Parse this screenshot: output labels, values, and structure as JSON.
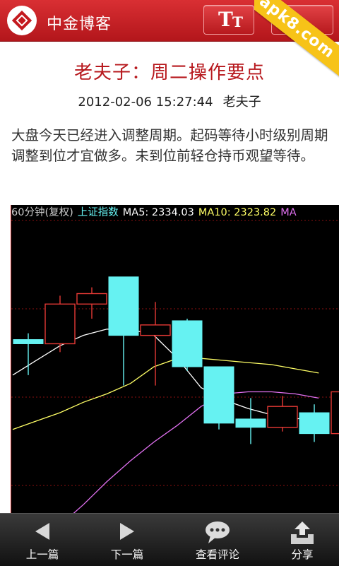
{
  "header": {
    "app_title": "中金博客",
    "font_button": {
      "big": "T",
      "small": "T"
    },
    "watermark": "apk8.com"
  },
  "article": {
    "title": "老夫子：周二操作要点",
    "date": "2012-02-06 15:27:44",
    "author": "老夫子",
    "body": "大盘今天已经进入调整周期。起码等待小时级别周期调整到位才宜做多。未到位前轻仓持币观望等待。"
  },
  "chart_data": {
    "type": "candlestick",
    "period_label": "60分钟(复权)",
    "index_label": "上证指数",
    "ma5_label": "MA5: 2334.03",
    "ma10_label": "MA10: 2323.82",
    "ma20_label": "MA",
    "colors": {
      "background": "#000000",
      "up": "#e53935",
      "down": "#66f2f2",
      "ma5": "#ffffff",
      "ma10": "#ffff66",
      "ma20": "#e070f0",
      "grid": "#8b1010",
      "label_grey": "#cccccc",
      "label_cyan": "#66f2f2"
    },
    "ylim": [
      2300,
      2370
    ],
    "candles": [
      {
        "o": 2341.5,
        "h": 2343.0,
        "l": 2333.0,
        "c": 2340.5
      },
      {
        "o": 2340.5,
        "h": 2352.0,
        "l": 2338.5,
        "c": 2350.0
      },
      {
        "o": 2350.0,
        "h": 2354.0,
        "l": 2346.5,
        "c": 2352.5
      },
      {
        "o": 2356.5,
        "h": 2356.5,
        "l": 2330.5,
        "c": 2342.5
      },
      {
        "o": 2342.5,
        "h": 2350.5,
        "l": 2330.5,
        "c": 2345.0
      },
      {
        "o": 2346.0,
        "h": 2346.5,
        "l": 2334.0,
        "c": 2335.0
      },
      {
        "o": 2335.0,
        "h": 2335.0,
        "l": 2320.0,
        "c": 2321.5
      },
      {
        "o": 2322.5,
        "h": 2327.5,
        "l": 2316.5,
        "c": 2320.5
      },
      {
        "o": 2320.5,
        "h": 2328.0,
        "l": 2319.5,
        "c": 2325.5
      },
      {
        "o": 2324.0,
        "h": 2326.0,
        "l": 2317.0,
        "c": 2319.0
      },
      {
        "o": 2319.0,
        "h": 2330.0,
        "l": 2316.0,
        "c": 2329.0
      }
    ],
    "ma5": [
      2333.0,
      2336.5,
      2340.0,
      2342.5,
      2344.0,
      2344.0,
      2342.5,
      2337.0,
      2330.0,
      2327.0,
      2325.0,
      2323.5,
      2322.5,
      2323.0
    ],
    "ma10": [
      2320.0,
      2322.0,
      2324.0,
      2326.5,
      2328.5,
      2331.0,
      2335.0,
      2337.0,
      2337.0,
      2336.5,
      2336.0,
      2335.5,
      2334.5,
      2333.5
    ],
    "ma20": [
      2287.0,
      2292.0,
      2297.0,
      2302.0,
      2307.5,
      2312.5,
      2317.0,
      2321.0,
      2325.5,
      2328.5,
      2329.0,
      2329.0,
      2328.5,
      2327.5
    ]
  },
  "footer": {
    "prev": "上一篇",
    "next": "下一篇",
    "comments": "查看评论",
    "share": "分享"
  }
}
